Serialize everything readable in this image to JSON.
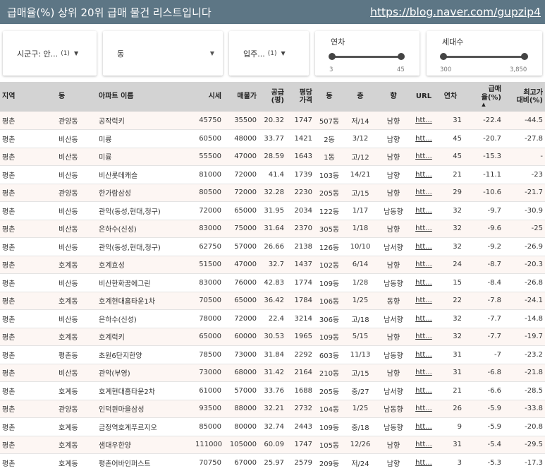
{
  "header": {
    "title": "급매율(%) 상위 20위 급매 물건 리스트입니다",
    "link": "https://blog.naver.com/gupzip4"
  },
  "filters": {
    "sigungu": {
      "label": "시군구: 안...",
      "count": "(1)"
    },
    "dong": {
      "label": "동"
    },
    "ipju": {
      "label": "입주...",
      "count": "(1)"
    },
    "year": {
      "title": "연차",
      "min": "3",
      "max": "45"
    },
    "households": {
      "title": "세대수",
      "min": "300",
      "max": "3,850"
    }
  },
  "table": {
    "headers": {
      "region": "지역",
      "dong": "동",
      "apt": "아파트 이름",
      "price": "시세",
      "sale": "매물가",
      "area": "공급\n(평)",
      "ppa": "평당\n가격",
      "bldg": "동",
      "floor": "층",
      "dir": "향",
      "url": "URL",
      "age": "연차",
      "rate": "급매\n율(%)",
      "drop": "최고가\n대비(%)"
    },
    "rows": [
      {
        "region": "평촌",
        "dong": "관양동",
        "apt": "공작럭키",
        "price": "45750",
        "sale": "35500",
        "area": "20.32",
        "ppa": "1747",
        "bldg": "507동",
        "floor": "저/14",
        "dir": "남향",
        "url": "htt...",
        "age": "31",
        "rate": "-22.4",
        "drop": "-44.5"
      },
      {
        "region": "평촌",
        "dong": "비산동",
        "apt": "미륭",
        "price": "60500",
        "sale": "48000",
        "area": "33.77",
        "ppa": "1421",
        "bldg": "2동",
        "floor": "3/12",
        "dir": "남향",
        "url": "htt...",
        "age": "45",
        "rate": "-20.7",
        "drop": "-27.8"
      },
      {
        "region": "평촌",
        "dong": "비산동",
        "apt": "미륭",
        "price": "55500",
        "sale": "47000",
        "area": "28.59",
        "ppa": "1643",
        "bldg": "1동",
        "floor": "고/12",
        "dir": "남향",
        "url": "htt...",
        "age": "45",
        "rate": "-15.3",
        "drop": "-"
      },
      {
        "region": "평촌",
        "dong": "비산동",
        "apt": "비산롯데캐슬",
        "price": "81000",
        "sale": "72000",
        "area": "41.4",
        "ppa": "1739",
        "bldg": "103동",
        "floor": "14/21",
        "dir": "남향",
        "url": "htt...",
        "age": "21",
        "rate": "-11.1",
        "drop": "-23"
      },
      {
        "region": "평촌",
        "dong": "관양동",
        "apt": "한가람삼성",
        "price": "80500",
        "sale": "72000",
        "area": "32.28",
        "ppa": "2230",
        "bldg": "205동",
        "floor": "고/15",
        "dir": "남향",
        "url": "htt...",
        "age": "29",
        "rate": "-10.6",
        "drop": "-21.7"
      },
      {
        "region": "평촌",
        "dong": "비산동",
        "apt": "관악(동성,현대,청구)",
        "price": "72000",
        "sale": "65000",
        "area": "31.95",
        "ppa": "2034",
        "bldg": "122동",
        "floor": "1/17",
        "dir": "남동향",
        "url": "htt...",
        "age": "32",
        "rate": "-9.7",
        "drop": "-30.9"
      },
      {
        "region": "평촌",
        "dong": "비산동",
        "apt": "은하수(신성)",
        "price": "83000",
        "sale": "75000",
        "area": "31.64",
        "ppa": "2370",
        "bldg": "305동",
        "floor": "1/18",
        "dir": "남향",
        "url": "htt...",
        "age": "32",
        "rate": "-9.6",
        "drop": "-25"
      },
      {
        "region": "평촌",
        "dong": "비산동",
        "apt": "관악(동성,현대,청구)",
        "price": "62750",
        "sale": "57000",
        "area": "26.66",
        "ppa": "2138",
        "bldg": "126동",
        "floor": "10/10",
        "dir": "남서향",
        "url": "htt...",
        "age": "32",
        "rate": "-9.2",
        "drop": "-26.9"
      },
      {
        "region": "평촌",
        "dong": "호계동",
        "apt": "호계효성",
        "price": "51500",
        "sale": "47000",
        "area": "32.7",
        "ppa": "1437",
        "bldg": "102동",
        "floor": "6/14",
        "dir": "남향",
        "url": "htt...",
        "age": "24",
        "rate": "-8.7",
        "drop": "-20.3"
      },
      {
        "region": "평촌",
        "dong": "비산동",
        "apt": "비산한화꿈에그린",
        "price": "83000",
        "sale": "76000",
        "area": "42.83",
        "ppa": "1774",
        "bldg": "109동",
        "floor": "1/28",
        "dir": "남동향",
        "url": "htt...",
        "age": "15",
        "rate": "-8.4",
        "drop": "-26.8"
      },
      {
        "region": "평촌",
        "dong": "호계동",
        "apt": "호계현대홈타운1차",
        "price": "70500",
        "sale": "65000",
        "area": "36.42",
        "ppa": "1784",
        "bldg": "106동",
        "floor": "1/25",
        "dir": "동향",
        "url": "htt...",
        "age": "22",
        "rate": "-7.8",
        "drop": "-24.1"
      },
      {
        "region": "평촌",
        "dong": "비산동",
        "apt": "은하수(신성)",
        "price": "78000",
        "sale": "72000",
        "area": "22.4",
        "ppa": "3214",
        "bldg": "306동",
        "floor": "고/18",
        "dir": "남서향",
        "url": "htt...",
        "age": "32",
        "rate": "-7.7",
        "drop": "-14.8"
      },
      {
        "region": "평촌",
        "dong": "호계동",
        "apt": "호계럭키",
        "price": "65000",
        "sale": "60000",
        "area": "30.53",
        "ppa": "1965",
        "bldg": "109동",
        "floor": "5/15",
        "dir": "남향",
        "url": "htt...",
        "age": "32",
        "rate": "-7.7",
        "drop": "-19.7"
      },
      {
        "region": "평촌",
        "dong": "평촌동",
        "apt": "초원6단지한양",
        "price": "78500",
        "sale": "73000",
        "area": "31.84",
        "ppa": "2292",
        "bldg": "603동",
        "floor": "11/13",
        "dir": "남동향",
        "url": "htt...",
        "age": "31",
        "rate": "-7",
        "drop": "-23.2"
      },
      {
        "region": "평촌",
        "dong": "비산동",
        "apt": "관악(부영)",
        "price": "73000",
        "sale": "68000",
        "area": "31.42",
        "ppa": "2164",
        "bldg": "210동",
        "floor": "고/15",
        "dir": "남향",
        "url": "htt...",
        "age": "31",
        "rate": "-6.8",
        "drop": "-21.8"
      },
      {
        "region": "평촌",
        "dong": "호계동",
        "apt": "호계현대홈타운2차",
        "price": "61000",
        "sale": "57000",
        "area": "33.76",
        "ppa": "1688",
        "bldg": "205동",
        "floor": "중/27",
        "dir": "남서향",
        "url": "htt...",
        "age": "21",
        "rate": "-6.6",
        "drop": "-28.5"
      },
      {
        "region": "평촌",
        "dong": "관양동",
        "apt": "인덕원마을삼성",
        "price": "93500",
        "sale": "88000",
        "area": "32.21",
        "ppa": "2732",
        "bldg": "104동",
        "floor": "1/25",
        "dir": "남동향",
        "url": "htt...",
        "age": "26",
        "rate": "-5.9",
        "drop": "-33.8"
      },
      {
        "region": "평촌",
        "dong": "호계동",
        "apt": "금정역호계푸르지오",
        "price": "85000",
        "sale": "80000",
        "area": "32.74",
        "ppa": "2443",
        "bldg": "109동",
        "floor": "중/18",
        "dir": "남동향",
        "url": "htt...",
        "age": "9",
        "rate": "-5.9",
        "drop": "-20.8"
      },
      {
        "region": "평촌",
        "dong": "호계동",
        "apt": "샘대우한양",
        "price": "111000",
        "sale": "105000",
        "area": "60.09",
        "ppa": "1747",
        "bldg": "105동",
        "floor": "12/26",
        "dir": "남향",
        "url": "htt...",
        "age": "31",
        "rate": "-5.4",
        "drop": "-29.5"
      },
      {
        "region": "평촌",
        "dong": "호계동",
        "apt": "평촌어바인퍼스트",
        "price": "70750",
        "sale": "67000",
        "area": "25.97",
        "ppa": "2579",
        "bldg": "209동",
        "floor": "저/24",
        "dir": "남향",
        "url": "htt...",
        "age": "3",
        "rate": "-5.3",
        "drop": "-17.3"
      }
    ]
  }
}
